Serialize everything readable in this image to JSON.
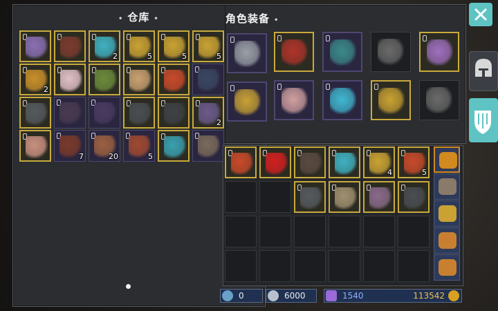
{
  "warehouse": {
    "title": "仓库",
    "slots": [
      {
        "icon": "armor-icon",
        "color": "#8a6fb3",
        "border": "gold",
        "qty": ""
      },
      {
        "icon": "claw-icon",
        "color": "#7a3b2e",
        "border": "gold",
        "qty": ""
      },
      {
        "icon": "crystal-icon",
        "color": "#3fb0c0",
        "border": "gold",
        "qty": "2"
      },
      {
        "icon": "scroll-icon",
        "color": "#c9a233",
        "border": "gold",
        "qty": "5"
      },
      {
        "icon": "scroll-icon",
        "color": "#c9a233",
        "border": "gold",
        "qty": "5"
      },
      {
        "icon": "scroll-icon",
        "color": "#c9a233",
        "border": "gold",
        "qty": "5"
      },
      {
        "icon": "book-icon",
        "color": "#c98f2a",
        "border": "gold",
        "qty": "2"
      },
      {
        "icon": "creature-icon",
        "color": "#e0c0c8",
        "border": "gold",
        "qty": ""
      },
      {
        "icon": "rune-icon",
        "color": "#6a8a3a",
        "border": "gold",
        "qty": ""
      },
      {
        "icon": "orb-icon",
        "color": "#c8a070",
        "border": "gold",
        "qty": ""
      },
      {
        "icon": "spiral-icon",
        "color": "#c84a2a",
        "border": "gold",
        "qty": ""
      },
      {
        "icon": "boots-icon",
        "color": "#3a4660",
        "border": "purple",
        "qty": ""
      },
      {
        "icon": "gauntlet-icon",
        "color": "#555a5e",
        "border": "gold",
        "qty": ""
      },
      {
        "icon": "belt-icon",
        "color": "#4a3a50",
        "border": "purple",
        "qty": ""
      },
      {
        "icon": "hood-icon",
        "color": "#4a3a60",
        "border": "purple",
        "qty": ""
      },
      {
        "icon": "leggings-icon",
        "color": "#4a4e52",
        "border": "gold",
        "qty": ""
      },
      {
        "icon": "chestplate-icon",
        "color": "#3e4246",
        "border": "gold",
        "qty": ""
      },
      {
        "icon": "shard-icon",
        "color": "#6a5a8a",
        "border": "gold",
        "qty": "2"
      },
      {
        "icon": "body-icon",
        "color": "#c89080",
        "border": "gold",
        "qty": ""
      },
      {
        "icon": "dagger-icon",
        "color": "#7a3a2a",
        "border": "purple",
        "qty": "7"
      },
      {
        "icon": "leaf-icon",
        "color": "#9a6040",
        "border": "purple",
        "qty": "20"
      },
      {
        "icon": "hide-icon",
        "color": "#a04a30",
        "border": "purple",
        "qty": "5"
      },
      {
        "icon": "robot-icon",
        "color": "#3aa0b0",
        "border": "gold",
        "qty": ""
      },
      {
        "icon": "sword-icon",
        "color": "#7a6a5a",
        "border": "purple",
        "qty": ""
      }
    ]
  },
  "equipment": {
    "title": "角色装备",
    "slots": [
      {
        "icon": "helmet-icon",
        "color": "#9aa0a6",
        "border": "purple"
      },
      {
        "icon": "necklace-icon",
        "color": "#c9a233",
        "border": "purple"
      },
      {
        "icon": "chest-armor-icon",
        "color": "#b0342a",
        "border": "gold"
      },
      {
        "icon": "shoulder-icon",
        "color": "#3a8a8a",
        "border": "purple"
      },
      {
        "icon": "ring-empty-icon",
        "color": "#6a6a6a",
        "border": "none"
      },
      {
        "icon": "axe-icon",
        "color": "#a070c0",
        "border": "gold"
      },
      {
        "icon": "glove-icon",
        "color": "#d0a0a0",
        "border": "purple"
      },
      {
        "icon": "boots-icon",
        "color": "#40b8d0",
        "border": "purple"
      },
      {
        "icon": "bracelet-icon",
        "color": "#c9a233",
        "border": "gold"
      },
      {
        "icon": "sword-empty-icon",
        "color": "#6a6a6a",
        "border": "none"
      }
    ]
  },
  "backpack": {
    "slots": [
      {
        "icon": "amulet-icon",
        "color": "#c84a2a",
        "border": "gold",
        "qty": ""
      },
      {
        "icon": "gem-icon",
        "color": "#d02020",
        "border": "gold",
        "qty": ""
      },
      {
        "icon": "boots-icon",
        "color": "#5a4a40",
        "border": "gold",
        "qty": ""
      },
      {
        "icon": "crystal-icon",
        "color": "#3fb0c0",
        "border": "gold",
        "qty": ""
      },
      {
        "icon": "scroll-icon",
        "color": "#c9a233",
        "border": "gold",
        "qty": "4"
      },
      {
        "icon": "spiral-icon",
        "color": "#c84a2a",
        "border": "gold",
        "qty": "5"
      },
      {
        "icon": "empty",
        "color": "",
        "border": "empty",
        "qty": ""
      },
      {
        "icon": "empty",
        "color": "",
        "border": "empty",
        "qty": ""
      },
      {
        "icon": "bow-icon",
        "color": "#555a5e",
        "border": "gold",
        "qty": ""
      },
      {
        "icon": "shield-icon",
        "color": "#a09070",
        "border": "gold",
        "qty": ""
      },
      {
        "icon": "spear-icon",
        "color": "#8a6a8a",
        "border": "gold",
        "qty": ""
      },
      {
        "icon": "leggings-icon",
        "color": "#4a4e52",
        "border": "gold",
        "qty": ""
      }
    ],
    "empty_rows": 2
  },
  "side_bags": [
    {
      "icon": "chest-icon",
      "color": "#d08a20"
    },
    {
      "icon": "backpack-icon",
      "color": "#8a7a6a"
    },
    {
      "icon": "pouch-icon",
      "color": "#c9a233"
    },
    {
      "icon": "bread-icon",
      "color": "#c88030"
    },
    {
      "icon": "bread-icon",
      "color": "#c88030"
    }
  ],
  "currency": {
    "tool_count": "0",
    "silver": "6000",
    "crystal": "1540",
    "gold": "113542"
  },
  "right_tabs": [
    {
      "icon": "helmet-icon"
    },
    {
      "icon": "shield-icon"
    }
  ]
}
